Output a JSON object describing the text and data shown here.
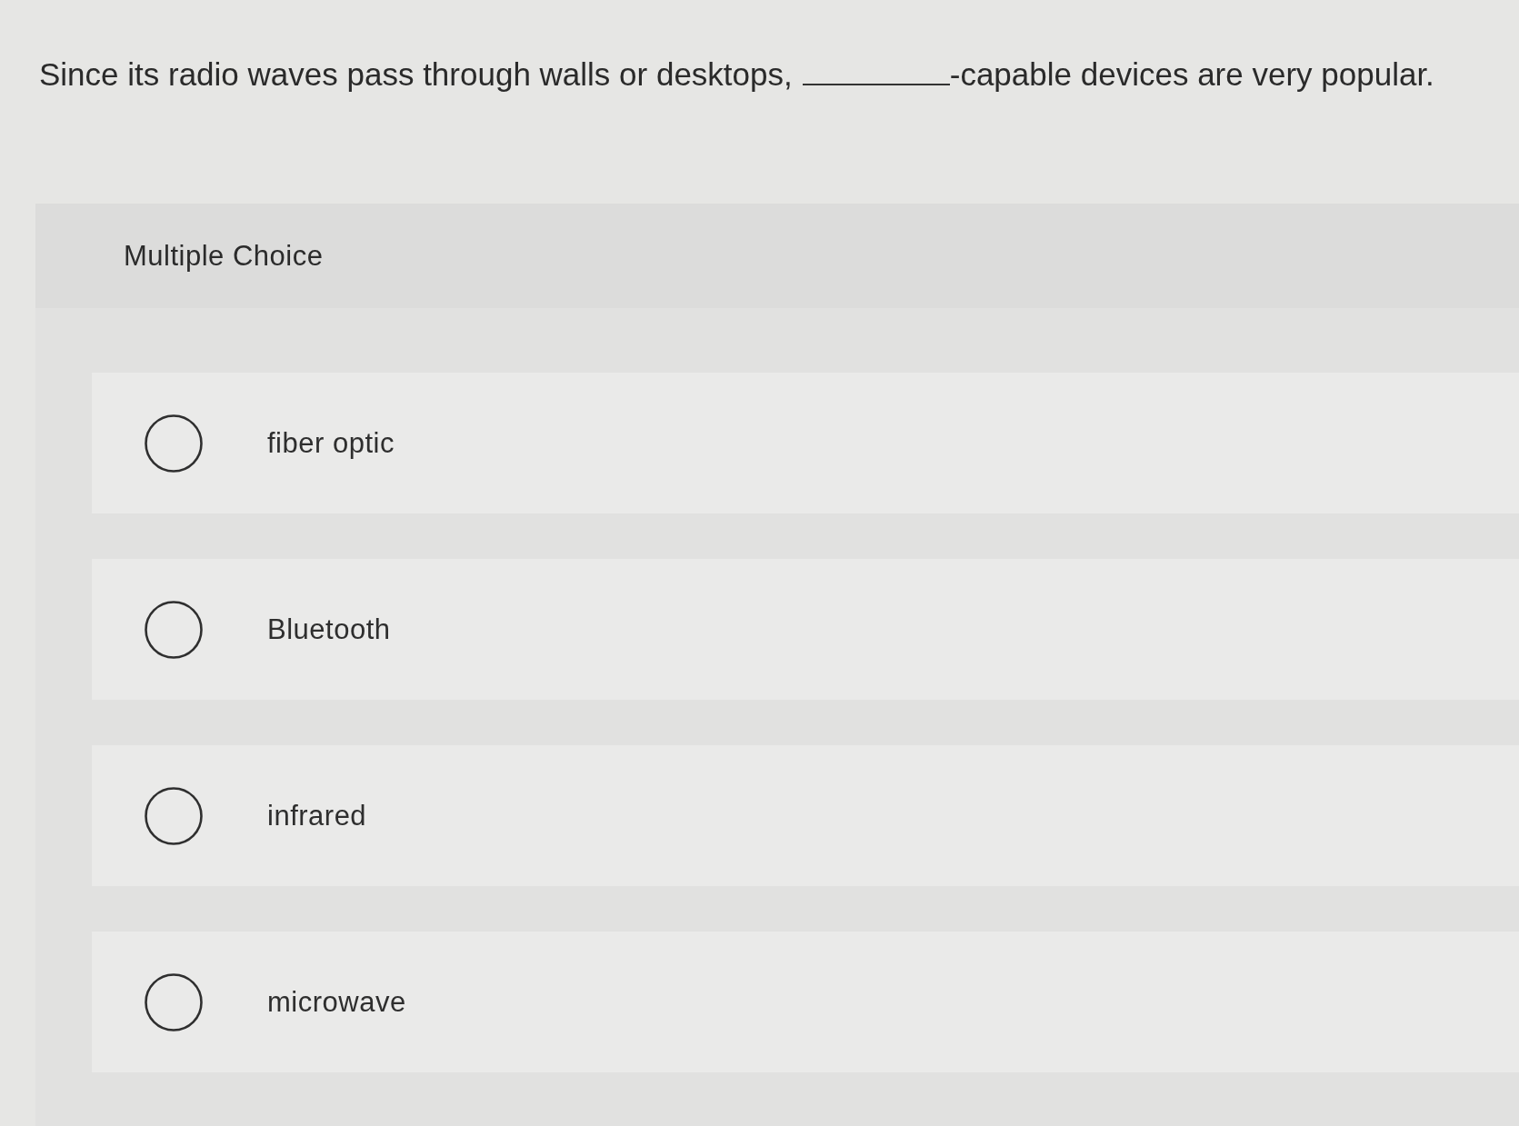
{
  "question": {
    "text_before_blank": "Since its radio waves pass through walls or desktops,",
    "text_after_blank": "-capable devices are very popular."
  },
  "answer_panel": {
    "heading": "Multiple Choice",
    "options": [
      {
        "label": "fiber optic",
        "selected": false
      },
      {
        "label": "Bluetooth",
        "selected": false
      },
      {
        "label": "infrared",
        "selected": false
      },
      {
        "label": "microwave",
        "selected": false
      }
    ]
  }
}
